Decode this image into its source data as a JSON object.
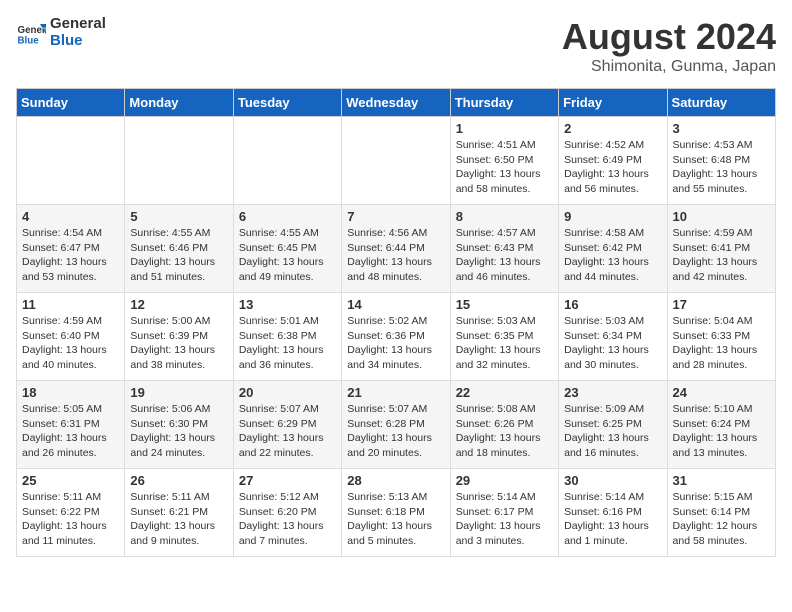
{
  "logo": {
    "line1": "General",
    "line2": "Blue"
  },
  "title": "August 2024",
  "subtitle": "Shimonita, Gunma, Japan",
  "days_of_week": [
    "Sunday",
    "Monday",
    "Tuesday",
    "Wednesday",
    "Thursday",
    "Friday",
    "Saturday"
  ],
  "weeks": [
    [
      {
        "day": "",
        "info": ""
      },
      {
        "day": "",
        "info": ""
      },
      {
        "day": "",
        "info": ""
      },
      {
        "day": "",
        "info": ""
      },
      {
        "day": "1",
        "info": "Sunrise: 4:51 AM\nSunset: 6:50 PM\nDaylight: 13 hours\nand 58 minutes."
      },
      {
        "day": "2",
        "info": "Sunrise: 4:52 AM\nSunset: 6:49 PM\nDaylight: 13 hours\nand 56 minutes."
      },
      {
        "day": "3",
        "info": "Sunrise: 4:53 AM\nSunset: 6:48 PM\nDaylight: 13 hours\nand 55 minutes."
      }
    ],
    [
      {
        "day": "4",
        "info": "Sunrise: 4:54 AM\nSunset: 6:47 PM\nDaylight: 13 hours\nand 53 minutes."
      },
      {
        "day": "5",
        "info": "Sunrise: 4:55 AM\nSunset: 6:46 PM\nDaylight: 13 hours\nand 51 minutes."
      },
      {
        "day": "6",
        "info": "Sunrise: 4:55 AM\nSunset: 6:45 PM\nDaylight: 13 hours\nand 49 minutes."
      },
      {
        "day": "7",
        "info": "Sunrise: 4:56 AM\nSunset: 6:44 PM\nDaylight: 13 hours\nand 48 minutes."
      },
      {
        "day": "8",
        "info": "Sunrise: 4:57 AM\nSunset: 6:43 PM\nDaylight: 13 hours\nand 46 minutes."
      },
      {
        "day": "9",
        "info": "Sunrise: 4:58 AM\nSunset: 6:42 PM\nDaylight: 13 hours\nand 44 minutes."
      },
      {
        "day": "10",
        "info": "Sunrise: 4:59 AM\nSunset: 6:41 PM\nDaylight: 13 hours\nand 42 minutes."
      }
    ],
    [
      {
        "day": "11",
        "info": "Sunrise: 4:59 AM\nSunset: 6:40 PM\nDaylight: 13 hours\nand 40 minutes."
      },
      {
        "day": "12",
        "info": "Sunrise: 5:00 AM\nSunset: 6:39 PM\nDaylight: 13 hours\nand 38 minutes."
      },
      {
        "day": "13",
        "info": "Sunrise: 5:01 AM\nSunset: 6:38 PM\nDaylight: 13 hours\nand 36 minutes."
      },
      {
        "day": "14",
        "info": "Sunrise: 5:02 AM\nSunset: 6:36 PM\nDaylight: 13 hours\nand 34 minutes."
      },
      {
        "day": "15",
        "info": "Sunrise: 5:03 AM\nSunset: 6:35 PM\nDaylight: 13 hours\nand 32 minutes."
      },
      {
        "day": "16",
        "info": "Sunrise: 5:03 AM\nSunset: 6:34 PM\nDaylight: 13 hours\nand 30 minutes."
      },
      {
        "day": "17",
        "info": "Sunrise: 5:04 AM\nSunset: 6:33 PM\nDaylight: 13 hours\nand 28 minutes."
      }
    ],
    [
      {
        "day": "18",
        "info": "Sunrise: 5:05 AM\nSunset: 6:31 PM\nDaylight: 13 hours\nand 26 minutes."
      },
      {
        "day": "19",
        "info": "Sunrise: 5:06 AM\nSunset: 6:30 PM\nDaylight: 13 hours\nand 24 minutes."
      },
      {
        "day": "20",
        "info": "Sunrise: 5:07 AM\nSunset: 6:29 PM\nDaylight: 13 hours\nand 22 minutes."
      },
      {
        "day": "21",
        "info": "Sunrise: 5:07 AM\nSunset: 6:28 PM\nDaylight: 13 hours\nand 20 minutes."
      },
      {
        "day": "22",
        "info": "Sunrise: 5:08 AM\nSunset: 6:26 PM\nDaylight: 13 hours\nand 18 minutes."
      },
      {
        "day": "23",
        "info": "Sunrise: 5:09 AM\nSunset: 6:25 PM\nDaylight: 13 hours\nand 16 minutes."
      },
      {
        "day": "24",
        "info": "Sunrise: 5:10 AM\nSunset: 6:24 PM\nDaylight: 13 hours\nand 13 minutes."
      }
    ],
    [
      {
        "day": "25",
        "info": "Sunrise: 5:11 AM\nSunset: 6:22 PM\nDaylight: 13 hours\nand 11 minutes."
      },
      {
        "day": "26",
        "info": "Sunrise: 5:11 AM\nSunset: 6:21 PM\nDaylight: 13 hours\nand 9 minutes."
      },
      {
        "day": "27",
        "info": "Sunrise: 5:12 AM\nSunset: 6:20 PM\nDaylight: 13 hours\nand 7 minutes."
      },
      {
        "day": "28",
        "info": "Sunrise: 5:13 AM\nSunset: 6:18 PM\nDaylight: 13 hours\nand 5 minutes."
      },
      {
        "day": "29",
        "info": "Sunrise: 5:14 AM\nSunset: 6:17 PM\nDaylight: 13 hours\nand 3 minutes."
      },
      {
        "day": "30",
        "info": "Sunrise: 5:14 AM\nSunset: 6:16 PM\nDaylight: 13 hours\nand 1 minute."
      },
      {
        "day": "31",
        "info": "Sunrise: 5:15 AM\nSunset: 6:14 PM\nDaylight: 12 hours\nand 58 minutes."
      }
    ]
  ]
}
